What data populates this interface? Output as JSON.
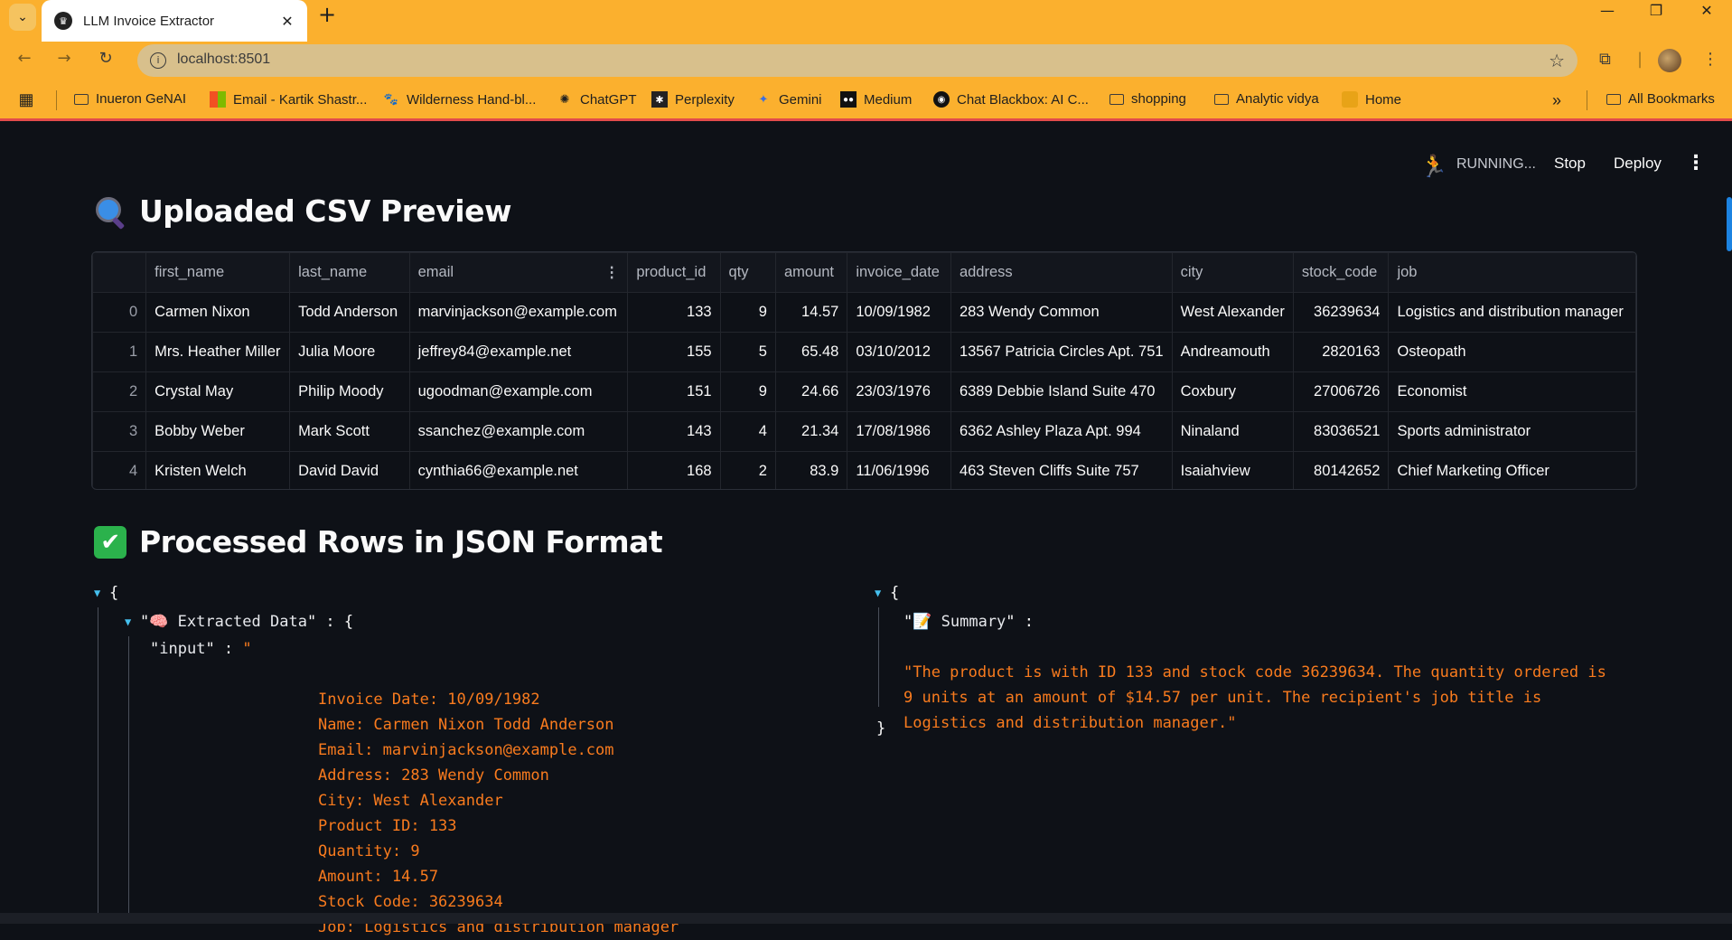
{
  "browser": {
    "tab_title": "LLM Invoice Extractor",
    "tab_favicon": "streamlit-crown-icon",
    "url": "localhost:8501",
    "bookmarks": [
      {
        "label": "Inueron GeNAI",
        "icon": "folder-icon"
      },
      {
        "label": "Email - Kartik Shastr...",
        "icon": "microsoft-icon"
      },
      {
        "label": "Wilderness Hand-bl...",
        "icon": "bear-icon"
      },
      {
        "label": "ChatGPT",
        "icon": "chatgpt-icon"
      },
      {
        "label": "Perplexity",
        "icon": "perplexity-icon"
      },
      {
        "label": "Gemini",
        "icon": "gemini-icon"
      },
      {
        "label": "Medium",
        "icon": "medium-icon"
      },
      {
        "label": "Chat Blackbox: AI C...",
        "icon": "blackbox-icon"
      },
      {
        "label": "shopping",
        "icon": "folder-icon"
      },
      {
        "label": "Analytic vidya",
        "icon": "folder-icon"
      },
      {
        "label": "Home",
        "icon": "box-icon"
      }
    ],
    "all_bookmarks": "All Bookmarks"
  },
  "app_header": {
    "status": "RUNNING...",
    "stop": "Stop",
    "deploy": "Deploy"
  },
  "preview": {
    "title": "Uploaded CSV Preview",
    "columns": [
      "first_name",
      "last_name",
      "email",
      "product_id",
      "qty",
      "amount",
      "invoice_date",
      "address",
      "city",
      "stock_code",
      "job"
    ],
    "rows": [
      [
        "0",
        "Carmen Nixon",
        "Todd Anderson",
        "marvinjackson@example.com",
        "133",
        "9",
        "14.57",
        "10/09/1982",
        "283 Wendy Common",
        "West Alexander",
        "36239634",
        "Logistics and distribution manager"
      ],
      [
        "1",
        "Mrs. Heather Miller",
        "Julia Moore",
        "jeffrey84@example.net",
        "155",
        "5",
        "65.48",
        "03/10/2012",
        "13567 Patricia Circles Apt. 751",
        "Andreamouth",
        "2820163",
        "Osteopath"
      ],
      [
        "2",
        "Crystal May",
        "Philip Moody",
        "ugoodman@example.com",
        "151",
        "9",
        "24.66",
        "23/03/1976",
        "6389 Debbie Island Suite 470",
        "Coxbury",
        "27006726",
        "Economist"
      ],
      [
        "3",
        "Bobby Weber",
        "Mark Scott",
        "ssanchez@example.com",
        "143",
        "4",
        "21.34",
        "17/08/1986",
        "6362 Ashley Plaza Apt. 994",
        "Ninaland",
        "83036521",
        "Sports administrator"
      ],
      [
        "4",
        "Kristen Welch",
        "David David",
        "cynthia66@example.net",
        "168",
        "2",
        "83.9",
        "11/06/1996",
        "463 Steven Cliffs Suite 757",
        "Isaiahview",
        "80142652",
        "Chief Marketing Officer"
      ]
    ]
  },
  "processed": {
    "title": "Processed Rows in JSON Format",
    "left": {
      "extracted_key": "🧠 Extracted Data",
      "input_key": "input",
      "input_lines": [
        "Invoice Date: 10/09/1982",
        "Name: Carmen Nixon Todd Anderson",
        "Email: marvinjackson@example.com",
        "Address: 283 Wendy Common",
        "City: West Alexander",
        "Product ID: 133",
        "Quantity: 9",
        "Amount: 14.57",
        "Stock Code: 36239634",
        "Job: Logistics and distribution manager"
      ]
    },
    "right": {
      "summary_key": "📝 Summary",
      "summary_lines": [
        "\"The product is with ID 133 and stock code 36239634. The quantity ordered is",
        "9 units at an amount of $14.57 per unit. The recipient's job title is",
        "Logistics and distribution manager.\""
      ]
    }
  },
  "colors": {
    "background": "#0e1117",
    "browser_accent": "#fbb02e",
    "json_string": "#f97b1e",
    "json_caret": "#45c0ee"
  }
}
